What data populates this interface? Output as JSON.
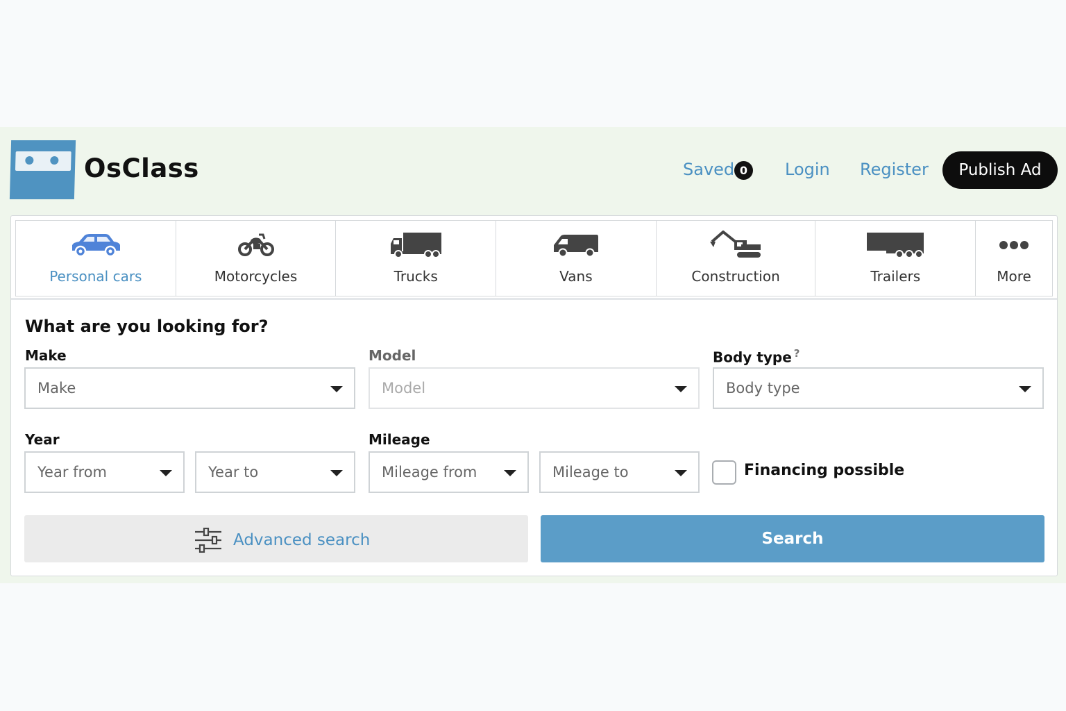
{
  "brand": {
    "name": "OsClass"
  },
  "nav": {
    "saved_label": "Saved",
    "saved_count": "0",
    "login_label": "Login",
    "register_label": "Register",
    "publish_label": "Publish Ad"
  },
  "categories": [
    {
      "label": "Personal cars",
      "icon": "car-icon",
      "active": true
    },
    {
      "label": "Motorcycles",
      "icon": "motorcycle-icon"
    },
    {
      "label": "Trucks",
      "icon": "truck-icon"
    },
    {
      "label": "Vans",
      "icon": "van-icon"
    },
    {
      "label": "Construction",
      "icon": "excavator-icon"
    },
    {
      "label": "Trailers",
      "icon": "trailer-icon"
    },
    {
      "label": "More",
      "icon": "more-dots-icon"
    }
  ],
  "form": {
    "title": "What are you looking for?",
    "make": {
      "label": "Make",
      "placeholder": "Make"
    },
    "model": {
      "label": "Model",
      "placeholder": "Model"
    },
    "body_type": {
      "label": "Body type",
      "help": "?",
      "placeholder": "Body type"
    },
    "year": {
      "label": "Year",
      "from": "Year from",
      "to": "Year to"
    },
    "mileage": {
      "label": "Mileage",
      "from": "Mileage from",
      "to": "Mileage to"
    },
    "financing_label": "Financing possible",
    "advanced_label": "Advanced search",
    "search_label": "Search"
  },
  "colors": {
    "accent": "#4a90c2",
    "search_button": "#5b9dc8",
    "header_band": "#eff6ec",
    "publish_button": "#0d0d0d"
  }
}
